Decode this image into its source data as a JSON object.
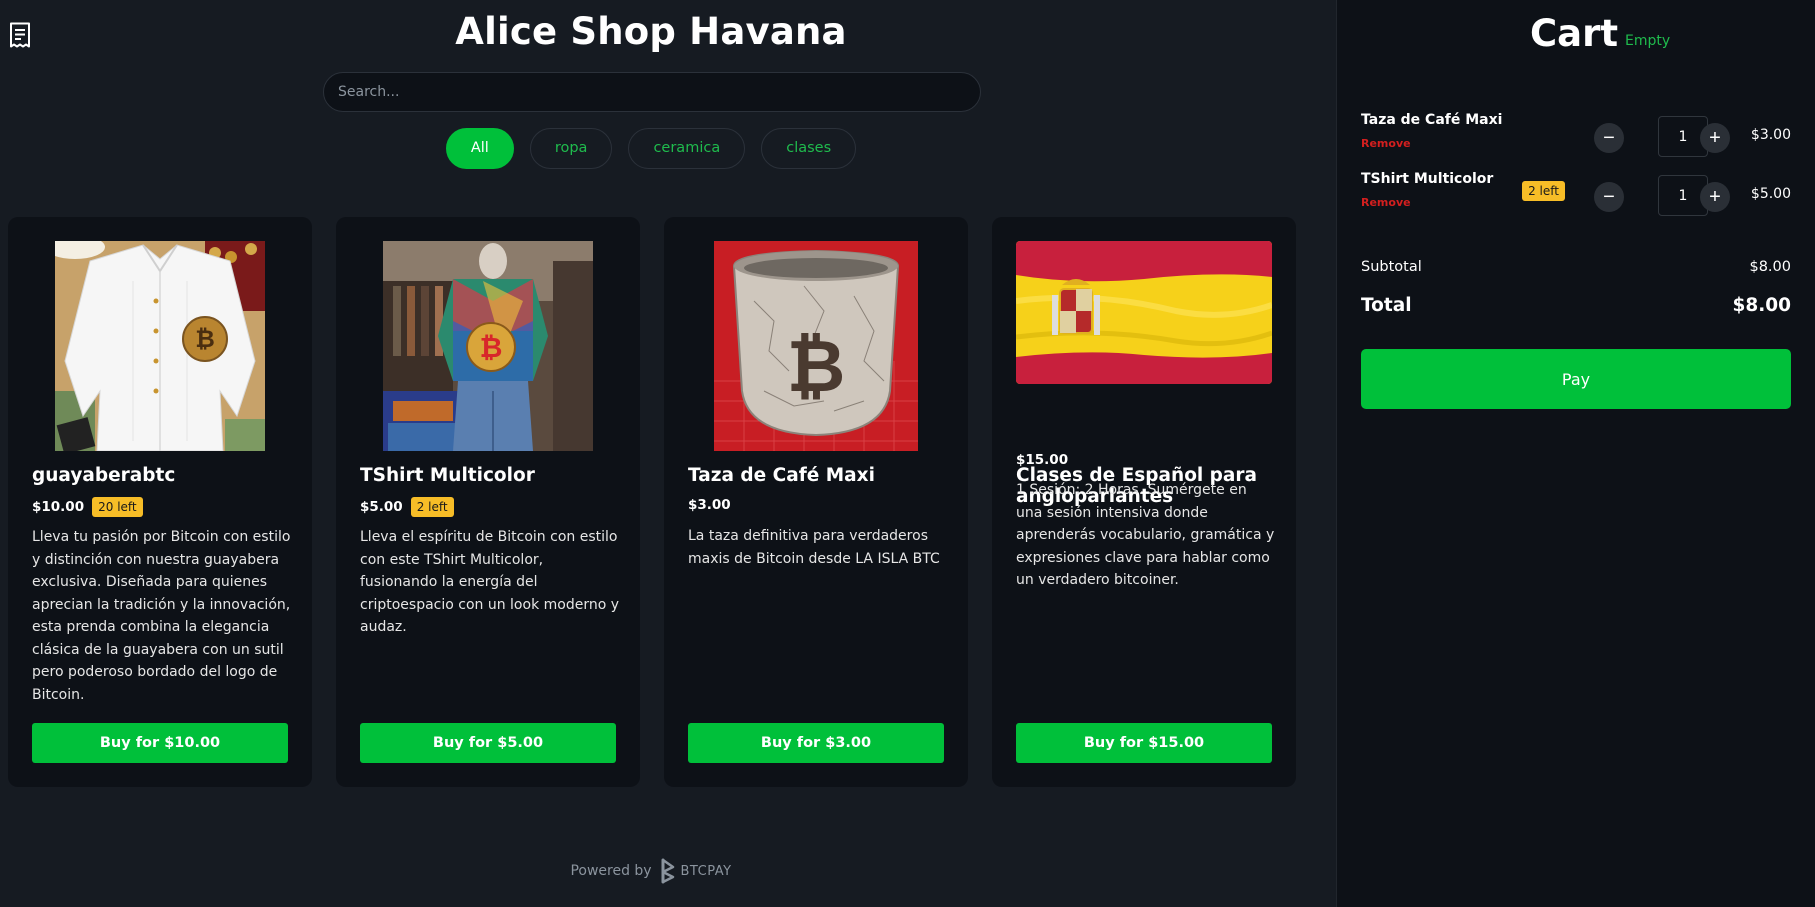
{
  "shop": {
    "title": "Alice Shop Havana",
    "search_placeholder": "Search...",
    "receipt_icon": "receipt-icon",
    "filters": [
      "All",
      "ropa",
      "ceramica",
      "clases"
    ],
    "active_filter": "All"
  },
  "products": [
    {
      "name": "guayaberabtc",
      "price": "$10.00",
      "stock": "20 left",
      "description": "Lleva tu pasión por Bitcoin con estilo y distinción con nuestra guayabera exclusiva. Diseñada para quienes aprecian la tradición y la innovación, esta prenda combina la elegancia clásica de la guayabera con un sutil pero poderoso bordado del logo de Bitcoin.",
      "buy_label": "Buy for $10.00"
    },
    {
      "name": "TShirt Multicolor",
      "price": "$5.00",
      "stock": "2 left",
      "description": "Lleva el espíritu de Bitcoin con estilo con este TShirt Multicolor, fusionando la energía del criptoespacio con un look moderno y audaz.",
      "buy_label": "Buy for $5.00"
    },
    {
      "name": "Taza de Café Maxi",
      "price": "$3.00",
      "stock": "",
      "description": "La taza definitiva para verdaderos maxis de Bitcoin desde LA ISLA BTC",
      "buy_label": "Buy for $3.00"
    },
    {
      "name": "Clases de Español para angloparlantes",
      "price": "$15.00",
      "stock": "",
      "description": "1 Sesión: 2 Horas. Sumérgete en una sesión intensiva donde aprenderás vocabulario, gramática y expresiones clave para hablar como un verdadero bitcoiner.",
      "buy_label": "Buy for $15.00"
    }
  ],
  "footer": {
    "powered_by": "Powered by",
    "brand": "BTCPAY"
  },
  "cart": {
    "title": "Cart",
    "empty_label": "Empty",
    "items": [
      {
        "name": "Taza de Café Maxi",
        "remove_label": "Remove",
        "badge": "",
        "qty": "1",
        "price": "$3.00"
      },
      {
        "name": "TShirt Multicolor",
        "remove_label": "Remove",
        "badge": "2 left",
        "qty": "1",
        "price": "$5.00"
      }
    ],
    "subtotal_label": "Subtotal",
    "subtotal_value": "$8.00",
    "total_label": "Total",
    "total_value": "$8.00",
    "pay_label": "Pay"
  },
  "colors": {
    "accent": "#00c03a",
    "warning_badge": "#f7bd27",
    "danger": "#d21f1f",
    "background": "#161b22",
    "panel": "#0d1117"
  }
}
